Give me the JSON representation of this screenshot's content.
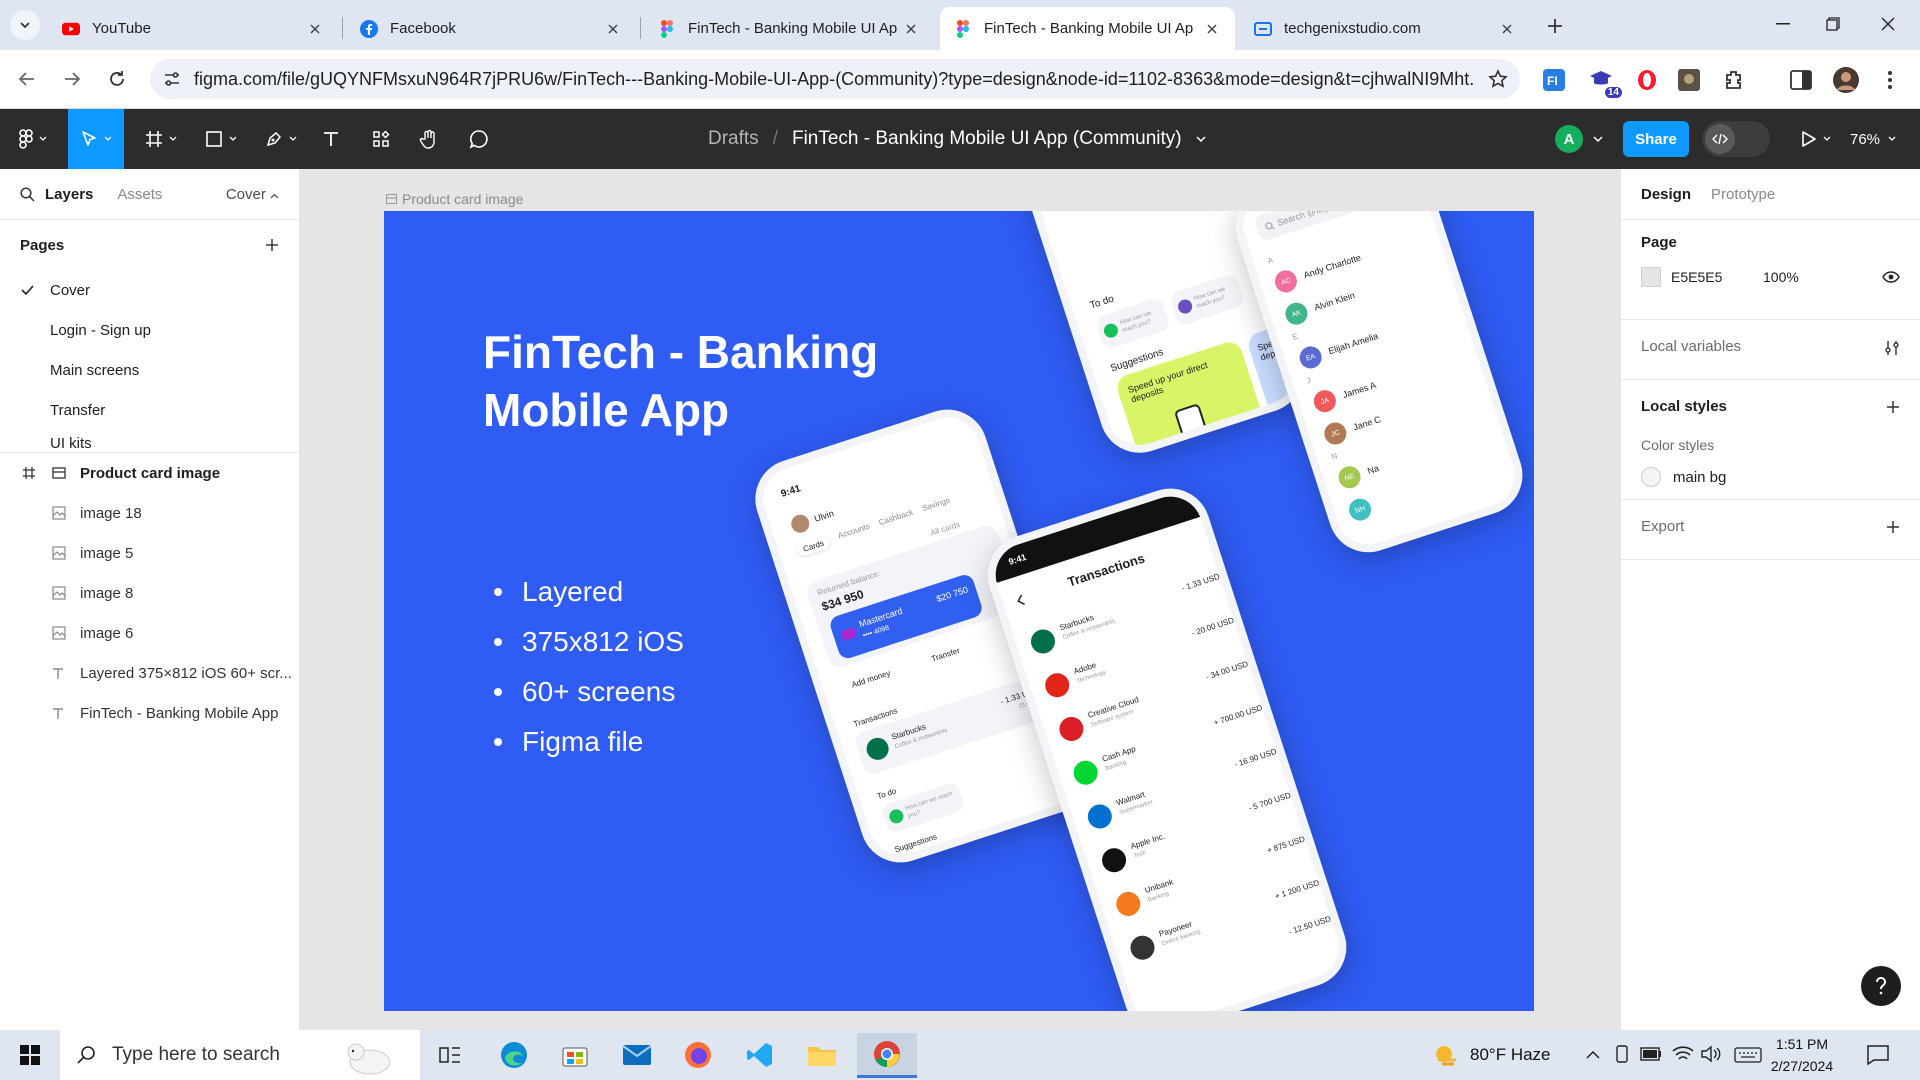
{
  "browser": {
    "tabs": [
      {
        "title": "YouTube",
        "icon": "youtube-icon",
        "active": false
      },
      {
        "title": "Facebook",
        "icon": "facebook-icon",
        "active": false
      },
      {
        "title": "FinTech - Banking Mobile UI Ap",
        "icon": "figma-icon",
        "active": false
      },
      {
        "title": "FinTech - Banking Mobile UI Ap",
        "icon": "figma-icon",
        "active": true
      },
      {
        "title": "techgenixstudio.com",
        "icon": "site-icon",
        "active": false
      }
    ],
    "url": "figma.com/file/gUQYNFMsxuN964R7jPRU6w/FinTech---Banking-Mobile-UI-App-(Community)?type=design&node-id=1102-8363&mode=design&t=cjhwalNI9Mht...",
    "extension_badge": "14"
  },
  "figma": {
    "breadcrumb_drafts": "Drafts",
    "breadcrumb_separator": "/",
    "file_name": "FinTech - Banking Mobile UI App (Community)",
    "avatar_letter": "A",
    "share_label": "Share",
    "zoom": "76%",
    "accent": "#0d99ff"
  },
  "left_panel": {
    "tab_layers": "Layers",
    "tab_assets": "Assets",
    "current_page_dropdown": "Cover",
    "pages_heading": "Pages",
    "pages": [
      "Cover",
      "Login - Sign up",
      "Main screens",
      "Transfer",
      "UI kits"
    ],
    "frame_layer": "Product card image",
    "child_layers": [
      {
        "name": "image 18",
        "type": "image"
      },
      {
        "name": "image 5",
        "type": "image"
      },
      {
        "name": "image 8",
        "type": "image"
      },
      {
        "name": "image 6",
        "type": "image"
      },
      {
        "name": "Layered 375×812 iOS 60+ scr...",
        "type": "text"
      },
      {
        "name": "FinTech - Banking Mobile App",
        "type": "text"
      }
    ]
  },
  "right_panel": {
    "tab_design": "Design",
    "tab_prototype": "Prototype",
    "page_heading": "Page",
    "page_color": "E5E5E5",
    "page_opacity": "100%",
    "local_variables": "Local variables",
    "local_styles": "Local styles",
    "color_styles": "Color styles",
    "color_style_name": "main bg",
    "export": "Export"
  },
  "canvas": {
    "frame_label": "Product card image",
    "artboard_color": "#2f5cf5",
    "title_line1": "FinTech - Banking",
    "title_line2": "Mobile App",
    "bullets": [
      "Layered",
      "375x812 iOS",
      "60+ screens",
      "Figma file"
    ],
    "phone_home": {
      "time": "9:41",
      "user": "Ulvin",
      "tabs": [
        "Cards",
        "Accounts",
        "Cashback",
        "Savings"
      ],
      "all_cards": "All cards",
      "balance_label": "Returned balance:",
      "balance": "$34 950",
      "card_name": "Mastercard",
      "card_number": "•••• 4098",
      "card_amount": "$20 750",
      "add_money": "Add money",
      "transfer": "Transfer",
      "transactions": "Transactions",
      "txn_name": "Starbucks",
      "txn_sub": "Coffee & restaurants",
      "txn_amount": "- 1.33 USD",
      "txn_date": "21.02.21",
      "todo": "To do",
      "todo_item": "How can we reach you?",
      "suggestions": "Suggestions"
    },
    "phone_suggest": {
      "todo": "To do",
      "todo_item": "How can we reach you?",
      "suggestions": "Suggestions",
      "card_text": "Speed up your direct deposits",
      "card2_text": "Speed deposi"
    },
    "phone_transactions": {
      "time": "9:41",
      "title": "Transactions",
      "items": [
        {
          "name": "Starbucks",
          "sub": "Coffee & restaurants",
          "amount": "- 1.33 USD",
          "color": "#00704a"
        },
        {
          "name": "Adobe",
          "sub": "Technology",
          "amount": "- 20.00 USD",
          "color": "#e1251b"
        },
        {
          "name": "Creative Cloud",
          "sub": "Software system",
          "amount": "- 34.00 USD",
          "color": "#da1f26"
        },
        {
          "name": "Cash App",
          "sub": "Banking",
          "amount": "+ 700.00 USD",
          "color": "#00d632"
        },
        {
          "name": "Walmart",
          "sub": "Supermarket",
          "amount": "- 16.90 USD",
          "color": "#0071ce"
        },
        {
          "name": "Apple Inc.",
          "sub": "Tech",
          "amount": "- 5 700 USD",
          "color": "#111111"
        },
        {
          "name": "Unibank",
          "sub": "Banking",
          "amount": "+ 875 USD",
          "color": "#f47b20"
        },
        {
          "name": "Payoneer",
          "sub": "Online banking",
          "amount": "+ 1 200 USD",
          "color": "#333333"
        }
      ],
      "last_amount": "- 12.50 USD"
    },
    "phone_contacts": {
      "search": "Search @tag, pho...",
      "contacts": [
        {
          "letter": "A",
          "name": "Andy Charlotte",
          "initials": "AC",
          "color": "#f06fa0"
        },
        {
          "letter": "",
          "name": "Alvin Klein",
          "initials": "AK",
          "color": "#3fb68b"
        },
        {
          "letter": "E",
          "name": "Elijah Amelia",
          "initials": "EA",
          "color": "#5b6bd6"
        },
        {
          "letter": "J",
          "name": "James A",
          "initials": "JA",
          "color": "#f05a5a"
        },
        {
          "letter": "",
          "name": "Jane C",
          "initials": "JC",
          "color": "#b07a55"
        },
        {
          "letter": "N",
          "name": "Na",
          "initials": "NE",
          "color": "#a3c94f"
        },
        {
          "letter": "",
          "name": "",
          "initials": "NH",
          "color": "#40c0c0"
        }
      ]
    }
  },
  "taskbar": {
    "search_placeholder": "Type here to search",
    "weather": "80°F  Haze",
    "time": "1:51 PM",
    "date": "2/27/2024"
  }
}
